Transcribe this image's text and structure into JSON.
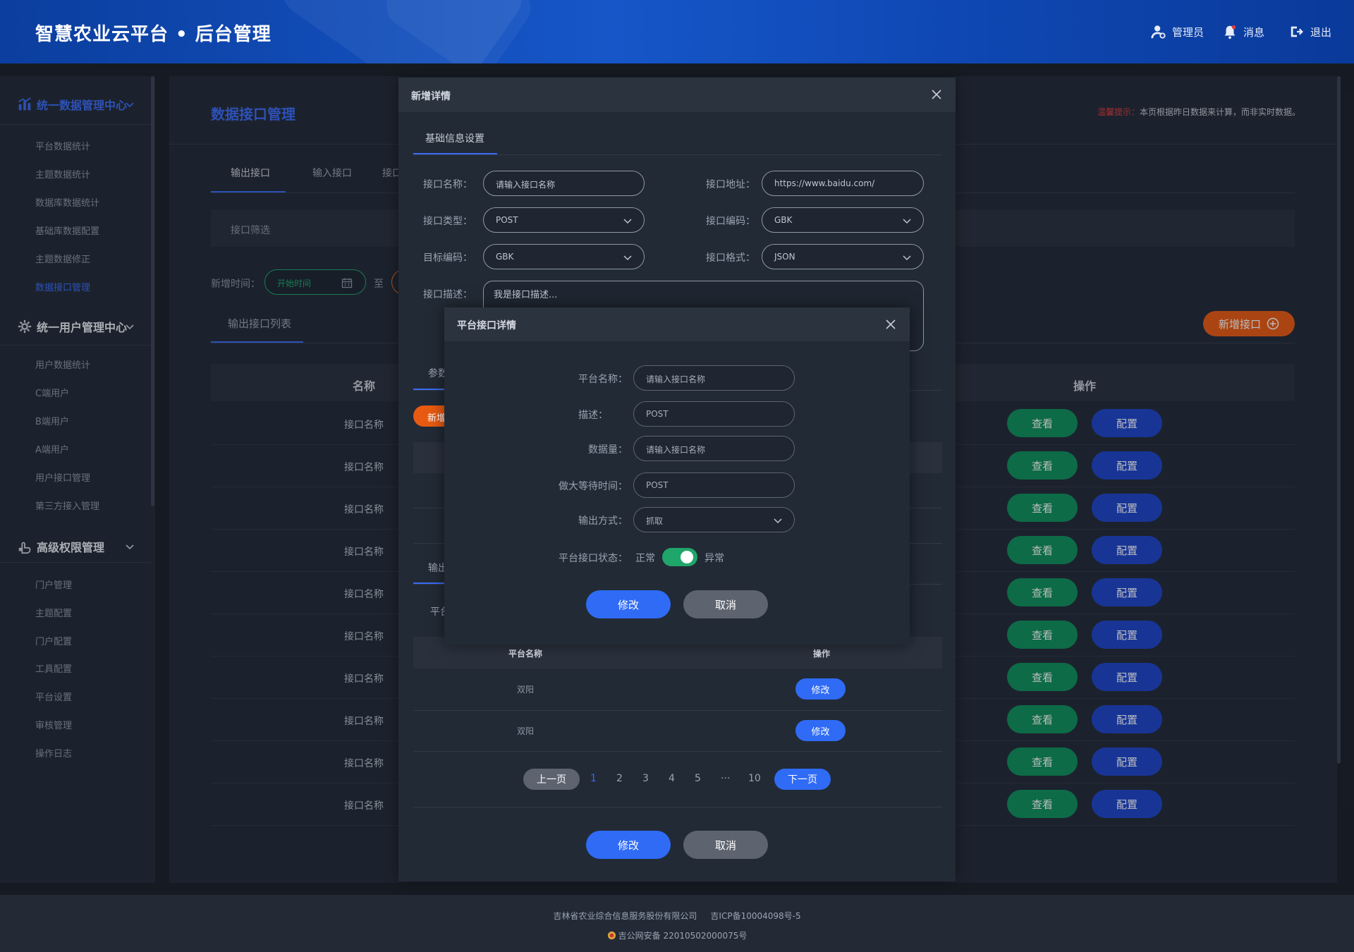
{
  "header": {
    "title": "智慧农业云平台 • 后台管理",
    "admin": "管理员",
    "messages": "消息",
    "logout": "退出"
  },
  "sidebar": {
    "groups": [
      {
        "label": "统一数据管理中心",
        "icon": "chart-icon",
        "items": [
          "平台数据统计",
          "主题数据统计",
          "数据库数据统计",
          "基础库数据配置",
          "主题数据修正",
          "数据接口管理"
        ]
      },
      {
        "label": "统一用户管理中心",
        "icon": "gear-icon",
        "items": [
          "用户数据统计",
          "C端用户",
          "B端用户",
          "A端用户",
          "用户接口管理",
          "第三方接入管理"
        ]
      },
      {
        "label": "高级权限管理",
        "icon": "hand-lock-icon",
        "items": [
          "门户管理",
          "主题配置",
          "门户配置",
          "工具配置",
          "平台设置",
          "审核管理",
          "操作日志"
        ]
      }
    ],
    "active_item": "数据接口管理"
  },
  "main": {
    "page_title": "数据接口管理",
    "tip_label": "温馨提示：",
    "tip_text": "本页根据昨日数据来计算，而非实时数据。",
    "tabs": [
      "输出接口",
      "输入接口",
      "接口"
    ],
    "filter_label": "接口筛选",
    "date_label": "新增时间：",
    "date_start_placeholder": "开始时间",
    "date_to": "至",
    "list_tab": "输出接口列表",
    "add_button": "新增接口",
    "table": {
      "col_name": "名称",
      "col_op": "操作",
      "rows": [
        "接口名称",
        "接口名称",
        "接口名称",
        "接口名称",
        "接口名称",
        "接口名称",
        "接口名称",
        "接口名称",
        "接口名称",
        "接口名称"
      ],
      "view_label": "查看",
      "config_label": "配置"
    }
  },
  "footer": {
    "line1": "吉林省农业综合信息服务股份有限公司     吉ICP备10004098号-5",
    "line2": "吉公网安备 22010502000075号"
  },
  "dialog_detail": {
    "title": "新增详情",
    "tab": "基础信息设置",
    "fields": {
      "name_label": "接口名称：",
      "name_placeholder": "请输入接口名称",
      "addr_label": "接口地址：",
      "addr_value": "https://www.baidu.com/",
      "type_label": "接口类型：",
      "type_value": "POST",
      "encoding_label": "接口编码：",
      "encoding_value": "GBK",
      "target_label": "目标编码：",
      "target_value": "GBK",
      "format_label": "接口格式：",
      "format_value": "JSON",
      "desc_label": "接口描述：",
      "desc_value": "我是接口描述..."
    },
    "params_tab": "参数",
    "new_partial": "新增",
    "output_tab": "输出",
    "platform_partial": "平台",
    "sub_table": {
      "col_name": "平台名称",
      "col_op": "操作",
      "rows": [
        "双阳",
        "双阳"
      ],
      "edit_label": "修改"
    },
    "pager": {
      "prev": "上一页",
      "pages": [
        "1",
        "2",
        "3",
        "4",
        "5",
        "···",
        "10"
      ],
      "active": "1",
      "next": "下一页"
    },
    "edit_button": "修改",
    "cancel_button": "取消"
  },
  "dialog_platform": {
    "title": "平台接口详情",
    "name_label": "平台名称：",
    "name_placeholder": "请输入接口名称",
    "desc_label": "描述：",
    "desc_value": "POST",
    "volume_label": "数据量：",
    "volume_placeholder": "请输入接口名称",
    "wait_label": "做大等待时间：",
    "wait_value": "POST",
    "output_label": "输出方式：",
    "output_value": "抓取",
    "status_label": "平台接口状态：",
    "status_on": "正常",
    "status_off": "异常",
    "status_enabled": true,
    "edit_button": "修改",
    "cancel_button": "取消"
  },
  "colors": {
    "accent": "#3b6bf5",
    "success": "#0f8f5a",
    "config": "#1e44c8",
    "orange": "#e85a12",
    "warning_red": "#e23c3c"
  }
}
